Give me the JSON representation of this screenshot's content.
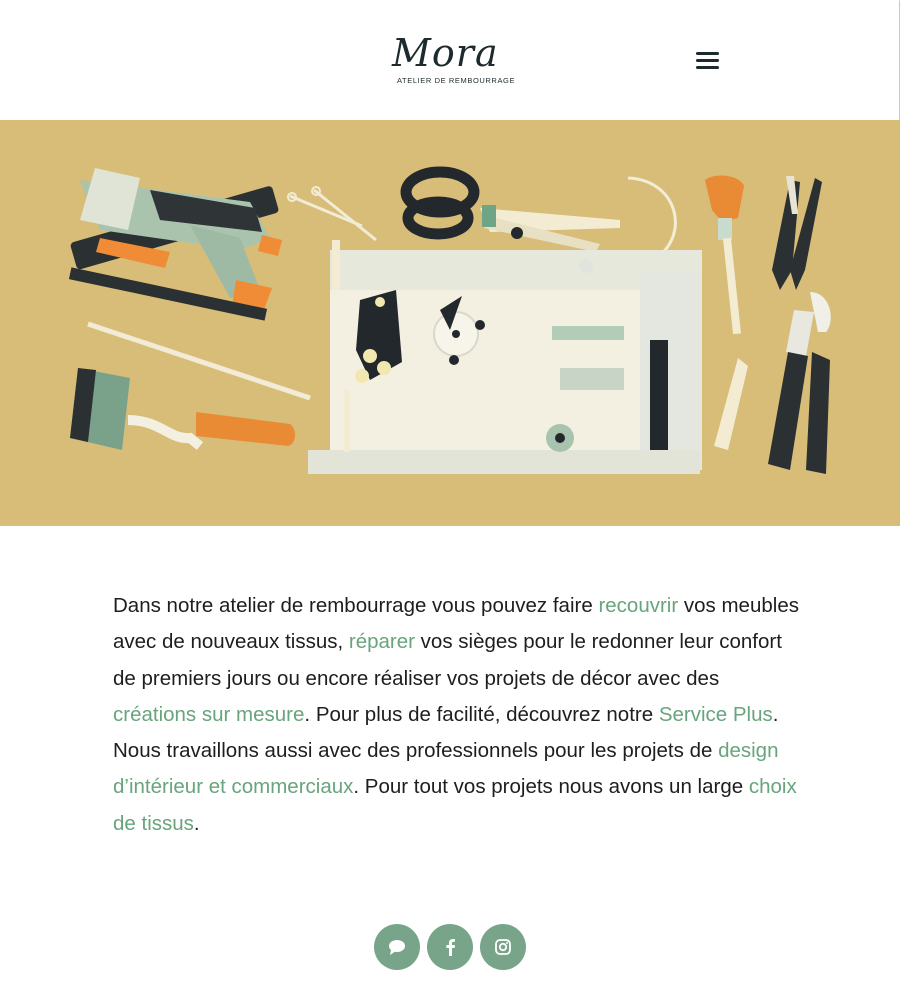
{
  "header": {
    "logo_word": "Mora",
    "logo_subtitle": "ATELIER DE REMBOURRAGE",
    "menu_icon": "hamburger-menu-icon"
  },
  "hero": {
    "background_color": "#d8bd79",
    "illustration_items": [
      "staple-gun",
      "needles",
      "scissors",
      "curved-needle",
      "mallet",
      "thread-snips",
      "sewing-machine",
      "upholstery-needle",
      "webbing-stretcher",
      "chalk",
      "pliers"
    ]
  },
  "intro": {
    "t1": "Dans notre atelier de rembourrage vous pouvez faire ",
    "link_recouvrir": "recouvrir",
    "t2": " vos meubles avec de nouveaux tissus, ",
    "link_reparer": "réparer",
    "t3": " vos sièges pour le redonner leur confort de premiers jours ou encore réaliser vos projets de décor avec des ",
    "link_creations": "créations sur mesure",
    "t4": ". Pour plus de facilité, découvrez notre ",
    "link_service_plus": "Service Plus",
    "t5": ". Nous travaillons aussi avec des professionnels pour les projets de ",
    "link_design": "design d’intérieur et commerciaux",
    "t6": ". Pour tout vos projets nous avons un large ",
    "link_choix": "choix de tissus",
    "t7": "."
  },
  "social": {
    "items": [
      {
        "icon": "chat-bubble-icon"
      },
      {
        "icon": "facebook-icon"
      },
      {
        "icon": "instagram-icon"
      }
    ]
  },
  "colors": {
    "accent_green": "#68a47c",
    "social_button": "#78a58a",
    "text": "#1e1e1e"
  }
}
